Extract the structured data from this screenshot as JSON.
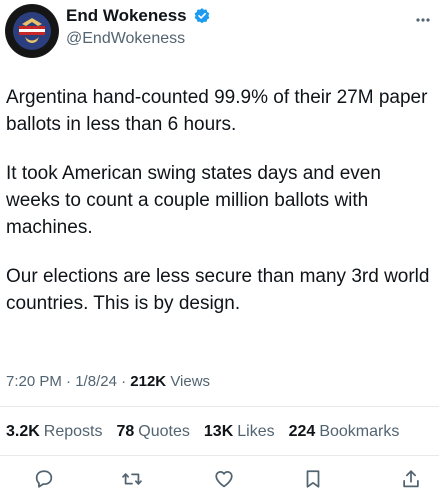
{
  "author": {
    "name": "End Wokeness",
    "handle": "@EndWokeness",
    "avatar_icon": "eagle-flag-logo-icon",
    "verified_icon": "verified-badge-icon",
    "verified_color": "#1d9bf0"
  },
  "tweet": {
    "paragraphs": [
      "Argentina hand-counted 99.9% of their 27M paper ballots in less than 6 hours.",
      "It took American swing states days and even weeks to count a couple million ballots with machines.",
      "Our elections are less secure than many 3rd world countries. This is by design."
    ],
    "time": "7:20 PM",
    "date": "1/8/24",
    "separator": "·",
    "views_count": "212K",
    "views_label": "Views"
  },
  "stats": {
    "reposts_count": "3.2K",
    "reposts_label": "Reposts",
    "quotes_count": "78",
    "quotes_label": "Quotes",
    "likes_count": "13K",
    "likes_label": "Likes",
    "bookmarks_count": "224",
    "bookmarks_label": "Bookmarks"
  },
  "actions": [
    {
      "name": "reply",
      "icon": "reply-bubble-icon"
    },
    {
      "name": "repost",
      "icon": "repost-arrows-icon"
    },
    {
      "name": "like",
      "icon": "heart-icon"
    },
    {
      "name": "bookmark",
      "icon": "bookmark-icon"
    },
    {
      "name": "share",
      "icon": "share-upload-icon"
    }
  ],
  "colors": {
    "text": "#0f1419",
    "secondary": "#536471",
    "divider": "#e7e9ea"
  }
}
